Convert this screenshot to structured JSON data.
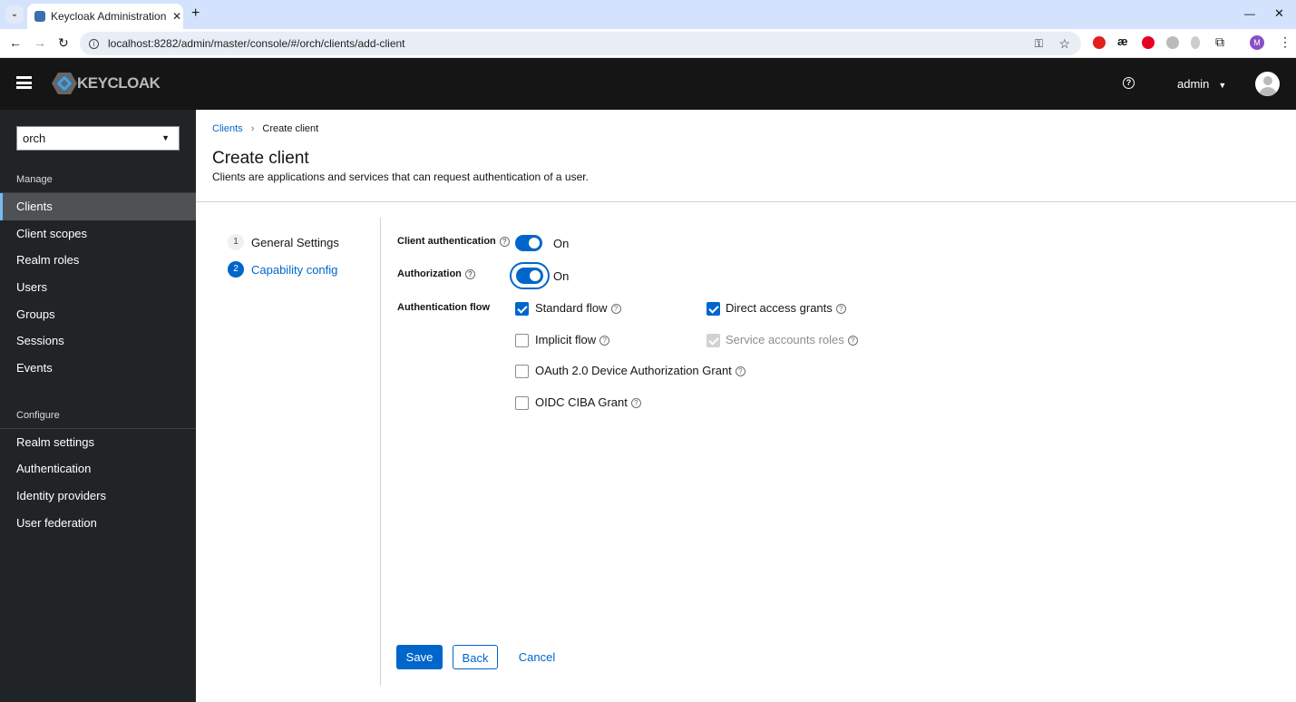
{
  "browser": {
    "tab_title": "Keycloak Administration Console",
    "url": "localhost:8282/admin/master/console/#/orch/clients/add-client",
    "profile_initial": "M"
  },
  "header": {
    "logo": "KEYCLOAK",
    "user": "admin"
  },
  "sidebar": {
    "realm": "orch",
    "manage_label": "Manage",
    "configure_label": "Configure",
    "manage_items": [
      {
        "label": "Clients",
        "active": true
      },
      {
        "label": "Client scopes"
      },
      {
        "label": "Realm roles"
      },
      {
        "label": "Users"
      },
      {
        "label": "Groups"
      },
      {
        "label": "Sessions"
      },
      {
        "label": "Events"
      }
    ],
    "configure_items": [
      {
        "label": "Realm settings"
      },
      {
        "label": "Authentication"
      },
      {
        "label": "Identity providers"
      },
      {
        "label": "User federation"
      }
    ]
  },
  "breadcrumb": {
    "parent": "Clients",
    "current": "Create client"
  },
  "page": {
    "title": "Create client",
    "subtitle": "Clients are applications and services that can request authentication of a user."
  },
  "wizard": {
    "steps": [
      {
        "num": "1",
        "label": "General Settings"
      },
      {
        "num": "2",
        "label": "Capability config",
        "active": true
      }
    ]
  },
  "form": {
    "client_auth_label": "Client authentication",
    "client_auth_value": "On",
    "authorization_label": "Authorization",
    "authorization_value": "On",
    "flow_label": "Authentication flow",
    "flows": [
      {
        "label": "Standard flow",
        "checked": true
      },
      {
        "label": "Direct access grants",
        "checked": true
      },
      {
        "label": "Implicit flow",
        "checked": false
      },
      {
        "label": "Service accounts roles",
        "checked": true,
        "disabled": true
      },
      {
        "label": "OAuth 2.0 Device Authorization Grant",
        "checked": false
      },
      {
        "label": "OIDC CIBA Grant",
        "checked": false
      }
    ]
  },
  "actions": {
    "save": "Save",
    "back": "Back",
    "cancel": "Cancel"
  },
  "colors": {
    "primary": "#0066cc",
    "header": "#151515",
    "sidebar": "#212427"
  }
}
